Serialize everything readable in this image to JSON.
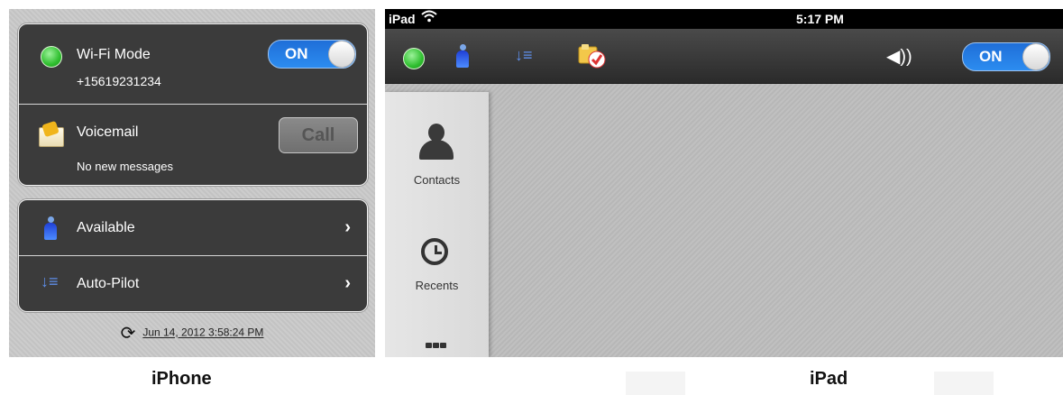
{
  "iphone": {
    "wifi": {
      "label": "Wi-Fi Mode",
      "number": "+15619231234",
      "toggle": "ON"
    },
    "voicemail": {
      "label": "Voicemail",
      "status": "No new messages",
      "button": "Call"
    },
    "available": {
      "label": "Available"
    },
    "autopilot": {
      "label": "Auto-Pilot"
    },
    "timestamp": "Jun 14, 2012 3:58:24 PM"
  },
  "ipad": {
    "statusbar": {
      "carrier": "iPad",
      "time": "5:17 PM"
    },
    "toolbar": {
      "toggle": "ON"
    },
    "sidebar": [
      {
        "label": "Contacts"
      },
      {
        "label": "Recents"
      }
    ]
  },
  "captions": {
    "iphone": "iPhone",
    "ipad": "iPad"
  },
  "colors": {
    "status_green": "#2fbf2f",
    "toggle_blue": "#2c8cf0",
    "panel_dark": "#3b3b3b"
  },
  "icons": {
    "available": "person-icon",
    "autopilot": "autopilot-icon",
    "voicemail": "envelope-icon",
    "sync": "refresh-icon",
    "speaker": "speaker-icon",
    "checklist": "checklist-icon",
    "recents": "clock-icon",
    "keypad": "keypad-icon",
    "wifi": "wifi-icon"
  }
}
